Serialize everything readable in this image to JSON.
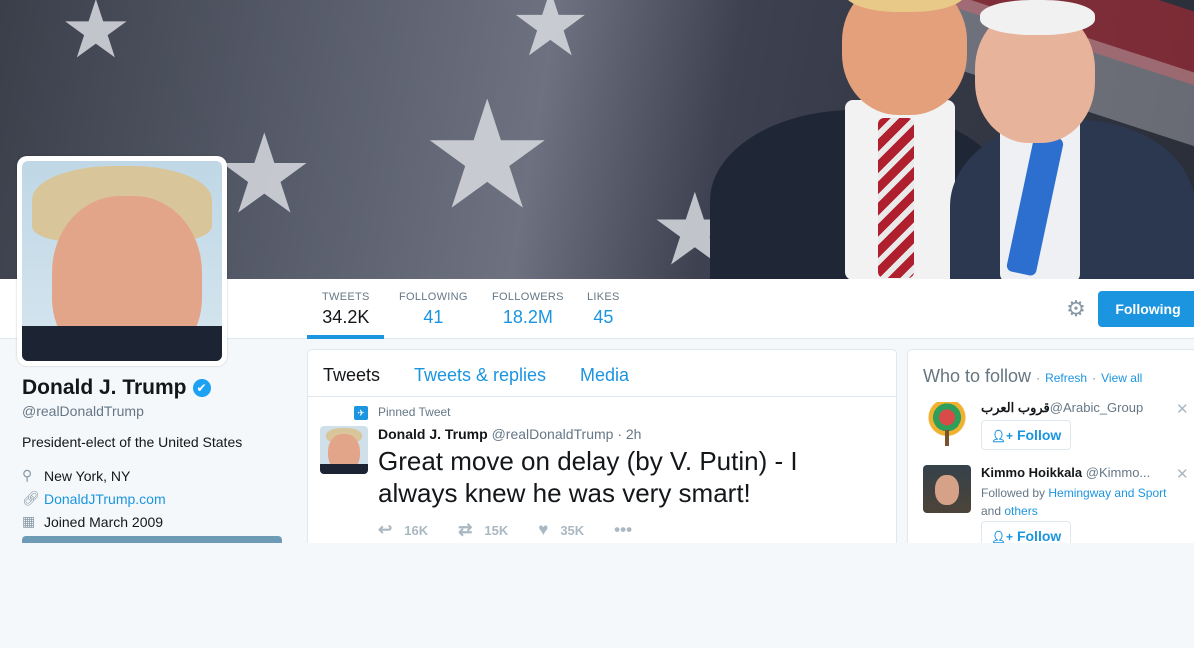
{
  "profile": {
    "name": "Donald J. Trump",
    "verified_glyph": "✔",
    "handle": "@realDonaldTrump",
    "bio": "President-elect of the United States",
    "location": "New York, NY",
    "website": "DonaldJTrump.com",
    "joined": "Joined March 2009"
  },
  "stats": [
    {
      "label": "TWEETS",
      "value": "34.2K"
    },
    {
      "label": "FOLLOWING",
      "value": "41"
    },
    {
      "label": "FOLLOWERS",
      "value": "18.2M"
    },
    {
      "label": "LIKES",
      "value": "45"
    }
  ],
  "navbar": {
    "following_button": "Following",
    "gear_icon": "⚙"
  },
  "tabs": [
    "Tweets",
    "Tweets & replies",
    "Media"
  ],
  "tweet": {
    "pinned_label": "Pinned Tweet",
    "author": "Donald J. Trump",
    "handle": "@realDonaldTrump",
    "time": "· 2h",
    "text": "Great move on delay (by V. Putin) - I always knew he was very smart!",
    "reply_count": "16K",
    "retweet_count": "15K",
    "like_count": "35K",
    "more_glyph": "•••"
  },
  "who_to_follow": {
    "title": "Who to follow",
    "sep": "·",
    "refresh": "Refresh",
    "view_all": "View all",
    "suggestions": [
      {
        "name": "قروب العرب",
        "handle": "@Arabic_Group",
        "follow_label": "Follow"
      },
      {
        "name": "Kimmo Hoikkala",
        "handle": "@Kimmo...",
        "context_prefix": "Followed by",
        "context_user1": "Hemingway and",
        "context_user2": "Sport",
        "context_and": "and",
        "context_suffix": "others",
        "follow_label": "Follow"
      }
    ],
    "dismiss_glyph": "✕"
  },
  "colors": {
    "accent": "#1b95e0",
    "verified": "#1da1f2",
    "background": "#f5f8fa"
  }
}
